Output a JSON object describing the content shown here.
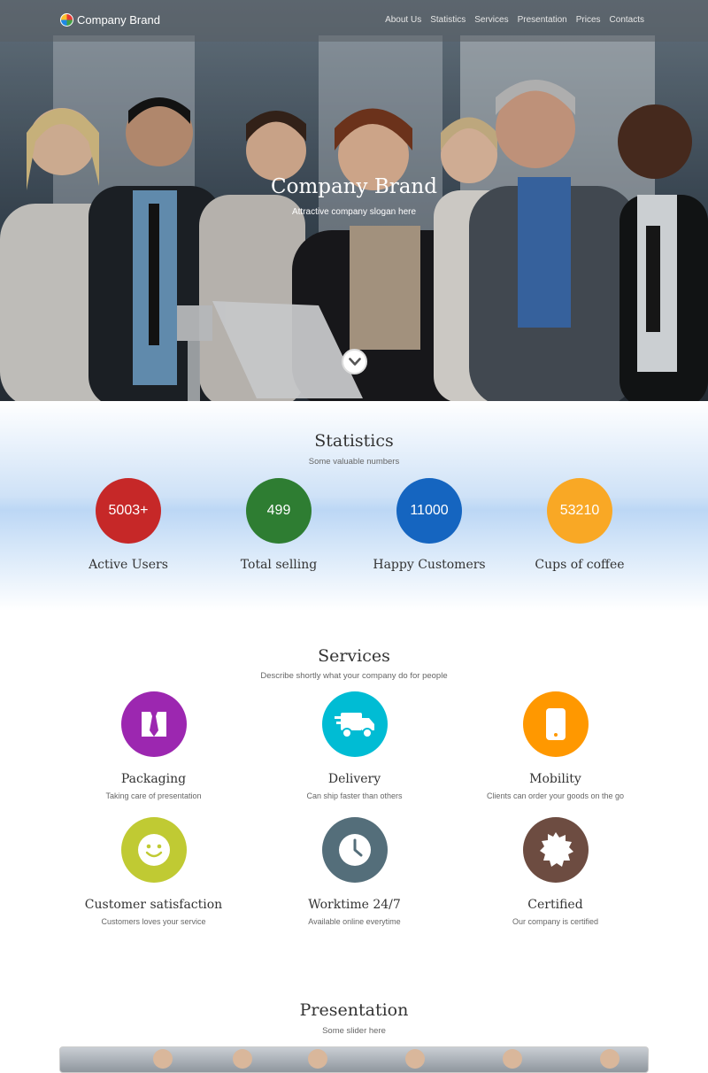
{
  "navbar": {
    "brand": "Company Brand",
    "links": [
      "About Us",
      "Statistics",
      "Services",
      "Presentation",
      "Prices",
      "Contacts"
    ]
  },
  "hero": {
    "title": "Company Brand",
    "slogan": "Attractive company slogan here"
  },
  "statistics": {
    "title": "Statistics",
    "subtitle": "Some valuable numbers",
    "items": [
      {
        "value": "5003+",
        "label": "Active Users",
        "color": "#c62828"
      },
      {
        "value": "499",
        "label": "Total selling",
        "color": "#2e7d32"
      },
      {
        "value": "11000",
        "label": "Happy Customers",
        "color": "#1565c0"
      },
      {
        "value": "53210",
        "label": "Cups of coffee",
        "color": "#f9a825"
      }
    ]
  },
  "services": {
    "title": "Services",
    "subtitle": "Describe shortly what your company do for people",
    "items": [
      {
        "name": "Packaging",
        "desc": "Taking care of presentation",
        "color": "#9c27b0",
        "icon": "tie-icon"
      },
      {
        "name": "Delivery",
        "desc": "Can ship faster than others",
        "color": "#00bcd4",
        "icon": "truck-icon"
      },
      {
        "name": "Mobility",
        "desc": "Clients can order your goods on the go",
        "color": "#ff9800",
        "icon": "mobile-icon"
      },
      {
        "name": "Customer satisfaction",
        "desc": "Customers loves your service",
        "color": "#c0ca33",
        "icon": "smile-icon"
      },
      {
        "name": "Worktime 24/7",
        "desc": "Available online everytime",
        "color": "#546e7a",
        "icon": "clock-icon"
      },
      {
        "name": "Certified",
        "desc": "Our company is certified",
        "color": "#6d4c41",
        "icon": "certificate-icon"
      }
    ]
  },
  "presentation": {
    "title": "Presentation",
    "subtitle": "Some slider here"
  }
}
